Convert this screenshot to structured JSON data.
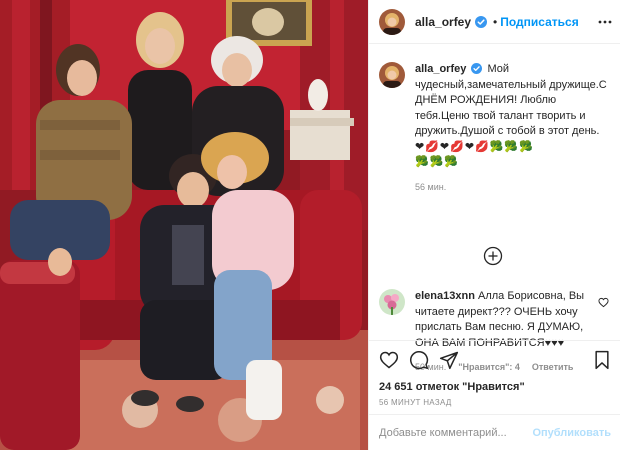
{
  "header": {
    "username": "alla_orfey",
    "follow_label": "Подписаться",
    "dot": "•"
  },
  "caption": {
    "username": "alla_orfey",
    "text": "Мой чудесный,замечательный дружище.С ДНЁМ РОЖДЕНИЯ! Люблю тебя.Ценю твой талант творить и дружить.Душой с тобой в этот день.",
    "emoji_line_1": "❤💋❤💋❤💋🥦🥦🥦",
    "emoji_line_2": "🥦🥦🥦",
    "time": "56 мин."
  },
  "comment": {
    "username": "elena13xnn",
    "text": "Алла Борисовна, Вы читаете директ??? ОЧЕНЬ хочу прислать Вам песню. Я ДУМАЮ, ОНА ВАМ ПОНРАВИТСЯ♥♥♥",
    "time": "50 мин.",
    "likes_label": "\"Нравится\": 4",
    "reply_label": "Ответить"
  },
  "actions": {
    "likes": "24 651 отметок \"Нравится\"",
    "time": "56 МИНУТ НАЗАД"
  },
  "add_comment": {
    "placeholder": "Добавьте комментарий...",
    "publish_label": "Опубликовать"
  },
  "icons": [
    "verified-badge-icon",
    "more-options-icon",
    "load-more-icon",
    "heart-icon",
    "comment-icon",
    "share-icon",
    "bookmark-icon"
  ],
  "colors": {
    "link_blue": "#0095f6",
    "publish_disabled": "#b2dffc",
    "muted": "#8e8e8e"
  }
}
